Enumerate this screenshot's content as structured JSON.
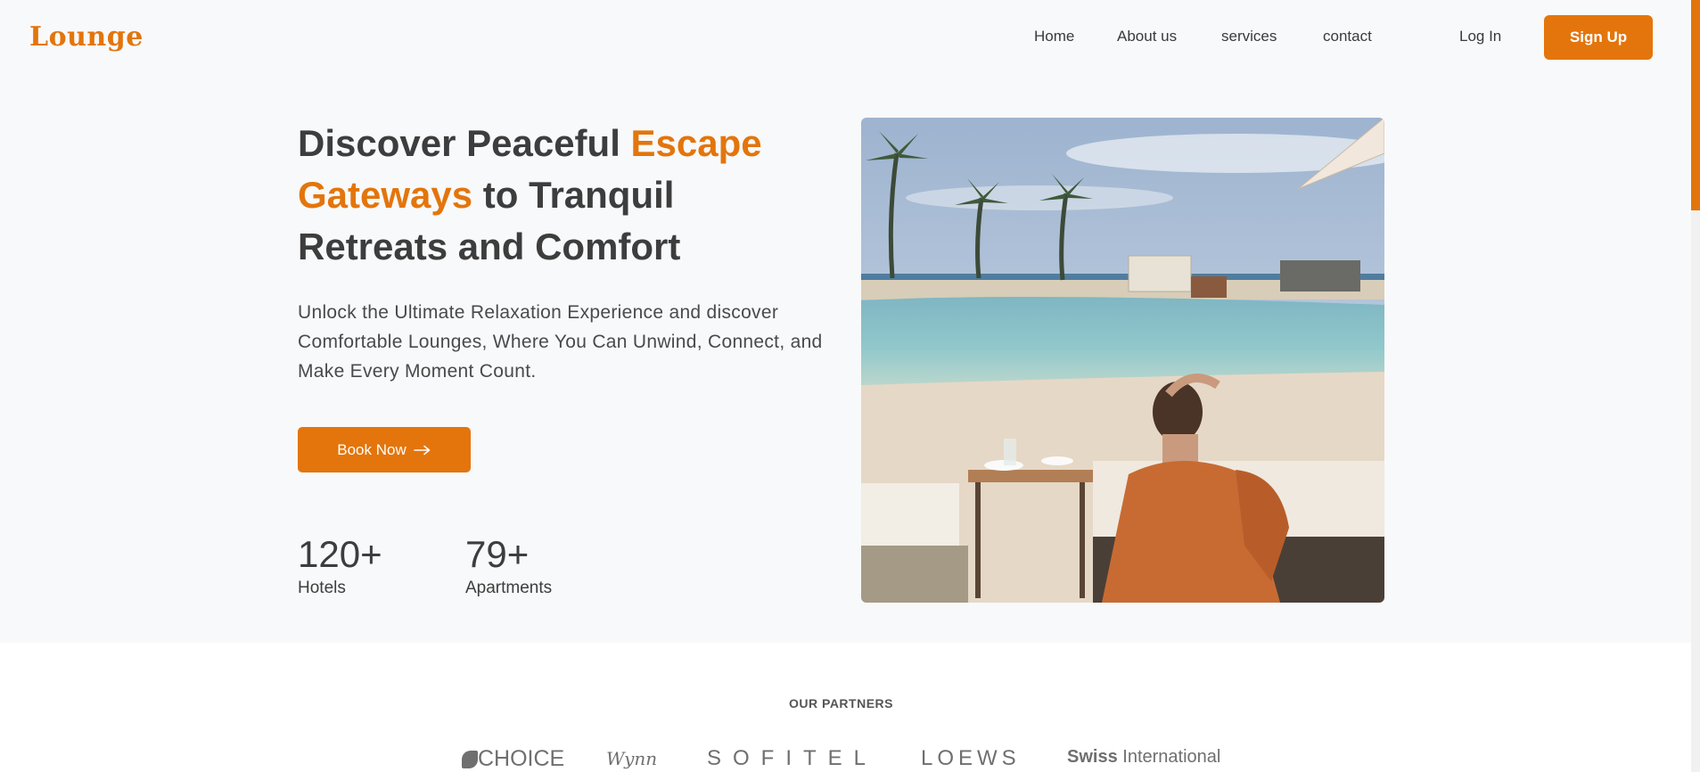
{
  "header": {
    "logo": "Lounge",
    "nav": [
      {
        "label": "Home"
      },
      {
        "label": "About us"
      },
      {
        "label": "services"
      },
      {
        "label": "contact"
      }
    ],
    "login_label": "Log In",
    "signup_label": "Sign Up"
  },
  "hero": {
    "title_part1": "Discover Peaceful ",
    "title_accent": "Escape Gateways",
    "title_part2": " to Tranquil Retreats and Comfort",
    "subtitle": "Unlock the Ultimate Relaxation Experience and discover Comfortable Lounges, Where You Can Unwind, Connect, and Make Every Moment Count.",
    "book_label": "Book Now",
    "book_icon": "arrow-right-icon",
    "stats": [
      {
        "value": "120+",
        "label": "Hotels"
      },
      {
        "value": "79+",
        "label": "Apartments"
      }
    ],
    "image": "resort-pool-photo"
  },
  "partners": {
    "title": "OUR PARTNERS",
    "logos": [
      {
        "name": "CHOICE"
      },
      {
        "name": "Wynn"
      },
      {
        "name": "SOFITEL"
      },
      {
        "name": "LOEWS"
      },
      {
        "name_bold": "Swiss",
        "name_rest": " International"
      }
    ]
  },
  "colors": {
    "accent": "#e3750c",
    "text": "#3d3d3d",
    "background": "#f8f9fa"
  }
}
